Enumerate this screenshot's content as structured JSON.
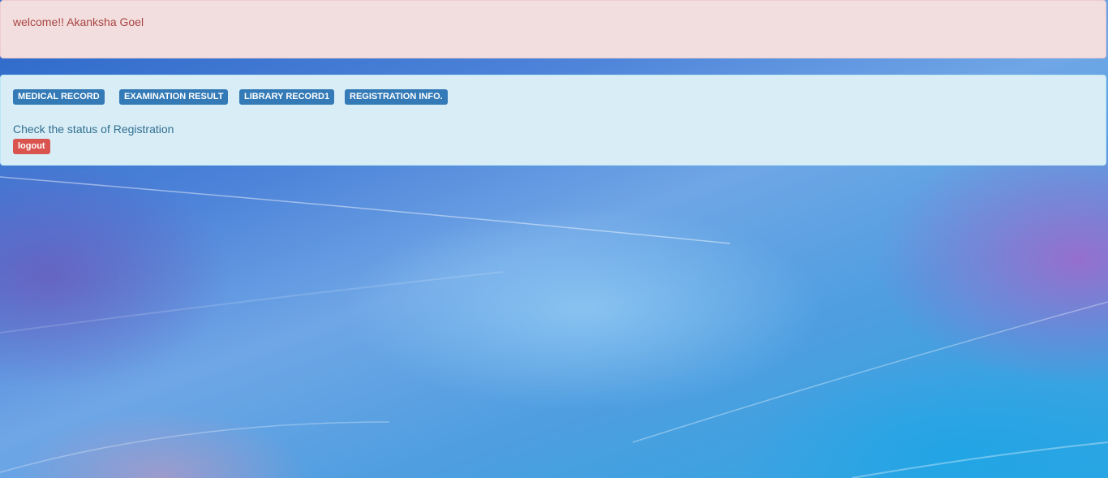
{
  "welcome": {
    "text": "welcome!! Akanksha Goel"
  },
  "nav": {
    "buttons": [
      {
        "label": "MEDICAL RECORD"
      },
      {
        "label": "EXAMINATION RESULT"
      },
      {
        "label": "LIBRARY RECORD1"
      },
      {
        "label": "REGISTRATION INFO."
      }
    ],
    "status_link": "Check the status of Registration",
    "logout": "logout"
  },
  "colors": {
    "alert_danger_bg": "#f2dede",
    "alert_danger_text": "#a94442",
    "alert_info_bg": "#d9edf7",
    "alert_info_text": "#31708f",
    "primary": "#337ab7",
    "danger": "#d9534f"
  }
}
